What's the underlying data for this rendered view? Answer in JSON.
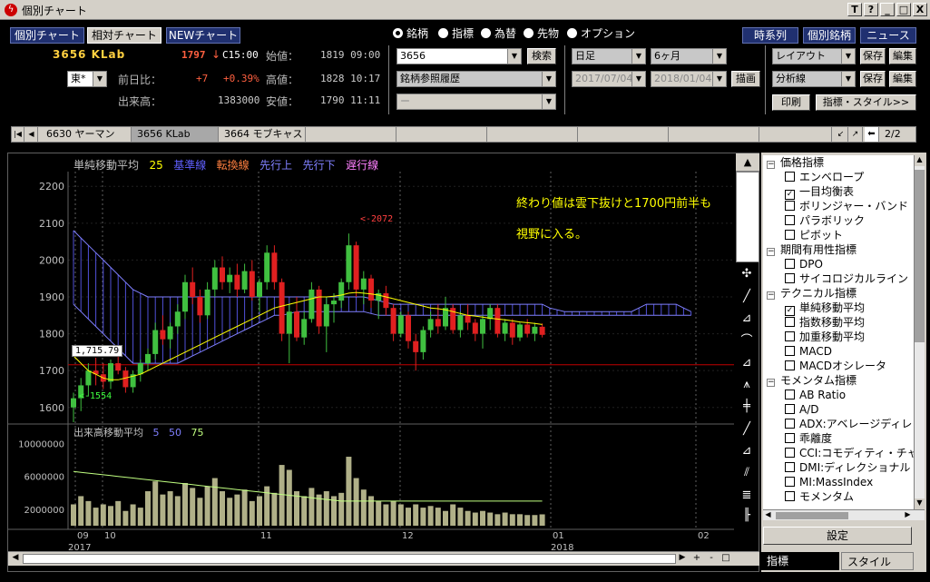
{
  "window": {
    "title": "個別チャート",
    "btn_t": "T",
    "btn_help": "?",
    "btn_min": "_",
    "btn_max": "□",
    "btn_close": "X"
  },
  "nav": {
    "tab_individual": "個別チャート",
    "tab_relative": "相対チャート",
    "tab_new": "NEWチャート"
  },
  "quote": {
    "code_name": "3656 KLab",
    "price": "1797",
    "arrow": "↓",
    "time": "C15:00",
    "open_label": "始値：",
    "open_value": "1819 09:00",
    "market": "東*",
    "change_label": "前日比：",
    "change": "+7",
    "change_pct": "+0.39%",
    "high_label": "高値：",
    "high_value": "1828 10:17",
    "volume_label": "出来高：",
    "volume": "1383000",
    "low_label": "安値：",
    "low_value": "1790 11:11"
  },
  "instrument_radios": [
    "銘柄",
    "指標",
    "為替",
    "先物",
    "オプション"
  ],
  "search": {
    "code": "3656",
    "search_btn": "検索",
    "history": "銘柄参照履歴",
    "empty": "ー"
  },
  "period": {
    "interval": "日足",
    "range": "6ヶ月",
    "from": "2017/07/04",
    "to": "2018/01/04",
    "draw_btn": "描画"
  },
  "right_buttons": {
    "timeseries": "時系列",
    "stock_name": "個別銘柄",
    "news": "ニュース",
    "layout": "レイアウト",
    "save": "保存",
    "edit": "編集",
    "analysis": "分析線",
    "print": "印刷",
    "indicator_style": "指標・スタイル>>"
  },
  "stock_tabs": [
    "6630 ヤーマン",
    "3656 KLab",
    "3664 モブキャス"
  ],
  "page_indicator": "2/2",
  "chart": {
    "legend": [
      {
        "text": "単純移動平均",
        "color": "#c0c0c0"
      },
      {
        "text": "25",
        "color": "#ffff00"
      },
      {
        "text": "基準線",
        "color": "#6060ff"
      },
      {
        "text": "転換線",
        "color": "#ff8040"
      },
      {
        "text": "先行上",
        "color": "#8080ff"
      },
      {
        "text": "先行下",
        "color": "#8080ff"
      },
      {
        "text": "遅行線",
        "color": "#ff80ff"
      }
    ],
    "annotation_line1": "終わり値は雲下抜けと1700円前半も",
    "annotation_line2": "視野に入る。",
    "high_marker": "<-2072",
    "low_marker": "<-1554",
    "cursor_value": "1,715.79",
    "price_ticks": [
      "2200",
      "2100",
      "2000",
      "1900",
      "1800",
      "1700",
      "1600"
    ],
    "volume_legend": [
      {
        "text": "出来高移動平均",
        "color": "#c0c0c0"
      },
      {
        "text": "5",
        "color": "#8080ff"
      },
      {
        "text": "50",
        "color": "#8080ff"
      },
      {
        "text": "75",
        "color": "#c0ff80"
      }
    ],
    "volume_ticks": [
      "10000000",
      "6000000",
      "2000000"
    ],
    "month_ticks": [
      "09",
      "10",
      "11",
      "12",
      "01",
      "02"
    ],
    "year_ticks": [
      "2017",
      "2018"
    ]
  },
  "chart_data": {
    "type": "candlestick",
    "title": "",
    "ylim": [
      1560,
      2240
    ],
    "price_ticks": [
      1600,
      1700,
      1800,
      1900,
      2000,
      2100,
      2200
    ],
    "reference_line": 1715.79,
    "candles": [
      [
        1600,
        1640,
        1560,
        1625
      ],
      [
        1625,
        1680,
        1590,
        1660
      ],
      [
        1660,
        1720,
        1630,
        1700
      ],
      [
        1700,
        1735,
        1660,
        1690
      ],
      [
        1690,
        1720,
        1650,
        1670
      ],
      [
        1670,
        1730,
        1650,
        1720
      ],
      [
        1720,
        1760,
        1690,
        1700
      ],
      [
        1700,
        1710,
        1640,
        1655
      ],
      [
        1655,
        1700,
        1640,
        1690
      ],
      [
        1690,
        1730,
        1670,
        1720
      ],
      [
        1720,
        1760,
        1700,
        1745
      ],
      [
        1745,
        1830,
        1730,
        1810
      ],
      [
        1810,
        1850,
        1770,
        1785
      ],
      [
        1785,
        1830,
        1760,
        1820
      ],
      [
        1820,
        1880,
        1800,
        1860
      ],
      [
        1860,
        1960,
        1840,
        1940
      ],
      [
        1940,
        1980,
        1880,
        1900
      ],
      [
        1900,
        1920,
        1830,
        1850
      ],
      [
        1850,
        1940,
        1840,
        1920
      ],
      [
        1920,
        2000,
        1900,
        1980
      ],
      [
        1980,
        2010,
        1920,
        1940
      ],
      [
        1940,
        1980,
        1910,
        1960
      ],
      [
        1960,
        1990,
        1900,
        1920
      ],
      [
        1920,
        1990,
        1910,
        1970
      ],
      [
        1970,
        2000,
        1890,
        1900
      ],
      [
        1900,
        1950,
        1860,
        1940
      ],
      [
        1940,
        2040,
        1920,
        2020
      ],
      [
        2020,
        2040,
        1920,
        1940
      ],
      [
        1940,
        1950,
        1780,
        1800
      ],
      [
        1800,
        1880,
        1720,
        1860
      ],
      [
        1860,
        1900,
        1780,
        1790
      ],
      [
        1790,
        1860,
        1770,
        1840
      ],
      [
        1840,
        1940,
        1830,
        1920
      ],
      [
        1920,
        1930,
        1800,
        1820
      ],
      [
        1820,
        1900,
        1750,
        1880
      ],
      [
        1880,
        1910,
        1830,
        1890
      ],
      [
        1890,
        1950,
        1870,
        1940
      ],
      [
        1940,
        2072,
        1920,
        2040
      ],
      [
        2040,
        2050,
        1900,
        1920
      ],
      [
        1920,
        1970,
        1880,
        1950
      ],
      [
        1950,
        1960,
        1870,
        1890
      ],
      [
        1890,
        1920,
        1840,
        1910
      ],
      [
        1910,
        1930,
        1850,
        1870
      ],
      [
        1870,
        1880,
        1780,
        1800
      ],
      [
        1800,
        1860,
        1790,
        1850
      ],
      [
        1850,
        1860,
        1760,
        1780
      ],
      [
        1780,
        1800,
        1700,
        1750
      ],
      [
        1750,
        1820,
        1730,
        1810
      ],
      [
        1810,
        1860,
        1790,
        1840
      ],
      [
        1840,
        1880,
        1800,
        1820
      ],
      [
        1820,
        1900,
        1810,
        1870
      ],
      [
        1870,
        1880,
        1800,
        1810
      ],
      [
        1810,
        1860,
        1790,
        1850
      ],
      [
        1850,
        1880,
        1810,
        1830
      ],
      [
        1830,
        1840,
        1780,
        1800
      ],
      [
        1800,
        1850,
        1760,
        1840
      ],
      [
        1840,
        1880,
        1810,
        1870
      ],
      [
        1870,
        1880,
        1790,
        1800
      ],
      [
        1800,
        1840,
        1780,
        1830
      ],
      [
        1830,
        1840,
        1770,
        1790
      ],
      [
        1790,
        1830,
        1780,
        1825
      ],
      [
        1825,
        1840,
        1790,
        1800
      ],
      [
        1800,
        1830,
        1780,
        1819
      ],
      [
        1819,
        1828,
        1790,
        1797
      ]
    ],
    "ma25": [
      1740,
      1720,
      1700,
      1690,
      1680,
      1675,
      1675,
      1680,
      1685,
      1690,
      1700,
      1710,
      1720,
      1730,
      1740,
      1750,
      1760,
      1770,
      1780,
      1790,
      1800,
      1810,
      1820,
      1830,
      1840,
      1850,
      1860,
      1870,
      1875,
      1880,
      1885,
      1890,
      1895,
      1900,
      1900,
      1902,
      1905,
      1910,
      1912,
      1910,
      1908,
      1905,
      1900,
      1895,
      1890,
      1885,
      1880,
      1875,
      1870,
      1868,
      1865,
      1860,
      1855,
      1850,
      1848,
      1845,
      1842,
      1840,
      1838,
      1835,
      1832,
      1830,
      1828,
      1825
    ],
    "cloud_upper": [
      2080,
      2060,
      2040,
      2020,
      2000,
      1980,
      1960,
      1940,
      1920,
      1910,
      1900,
      1900,
      1900,
      1900,
      1900,
      1900,
      1900,
      1900,
      1900,
      1900,
      1900,
      1900,
      1900,
      1900,
      1900,
      1900,
      1900,
      1900,
      1900,
      1900,
      1900,
      1900,
      1900,
      1900,
      1900,
      1900,
      1900,
      1900,
      1900,
      1900,
      1895,
      1890,
      1885,
      1880,
      1880,
      1880,
      1880,
      1880,
      1880,
      1880,
      1880,
      1880,
      1880,
      1880,
      1880,
      1880,
      1880,
      1880,
      1880,
      1880,
      1880,
      1880,
      1880,
      1880,
      1870,
      1865,
      1860,
      1860,
      1860,
      1860,
      1860,
      1860,
      1860,
      1860,
      1860,
      1860,
      1870,
      1880,
      1880,
      1880,
      1880,
      1880,
      1870,
      1860
    ],
    "cloud_lower": [
      1880,
      1860,
      1840,
      1820,
      1800,
      1780,
      1760,
      1740,
      1720,
      1720,
      1720,
      1720,
      1720,
      1720,
      1720,
      1730,
      1740,
      1750,
      1760,
      1770,
      1780,
      1790,
      1800,
      1810,
      1820,
      1830,
      1840,
      1850,
      1850,
      1855,
      1860,
      1860,
      1860,
      1860,
      1860,
      1860,
      1860,
      1860,
      1860,
      1860,
      1855,
      1850,
      1850,
      1850,
      1850,
      1850,
      1850,
      1850,
      1850,
      1850,
      1850,
      1850,
      1850,
      1850,
      1850,
      1850,
      1850,
      1850,
      1850,
      1850,
      1850,
      1850,
      1850,
      1850,
      1850,
      1850,
      1850,
      1850,
      1850,
      1850,
      1850,
      1850,
      1850,
      1850,
      1850,
      1850,
      1850,
      1850,
      1850,
      1850,
      1850,
      1850,
      1850,
      1850
    ],
    "volume_ylim": [
      0,
      11500000
    ],
    "volumes": [
      2600000,
      3600000,
      3000000,
      2200000,
      2600000,
      2400000,
      3000000,
      1800000,
      2600000,
      2200000,
      4200000,
      5400000,
      3800000,
      4200000,
      3600000,
      5200000,
      4600000,
      3400000,
      4800000,
      5800000,
      4200000,
      3400000,
      3800000,
      4400000,
      3000000,
      3600000,
      4800000,
      4000000,
      7400000,
      6800000,
      4200000,
      3600000,
      4600000,
      3800000,
      4200000,
      3600000,
      4000000,
      8400000,
      5800000,
      4400000,
      3600000,
      3000000,
      2600000,
      3000000,
      2600000,
      2200000,
      2600000,
      2200000,
      2400000,
      2200000,
      1800000,
      2600000,
      2200000,
      1800000,
      1600000,
      1800000,
      1600000,
      1400000,
      1600000,
      1400000,
      1400000,
      1300000,
      1300000,
      1383000
    ],
    "volume_ma_long": [
      6600000,
      6500000,
      6400000,
      6300000,
      6200000,
      6100000,
      6000000,
      5900000,
      5800000,
      5700000,
      5600000,
      5500000,
      5400000,
      5300000,
      5200000,
      5100000,
      5000000,
      4900000,
      4800000,
      4700000,
      4600000,
      4500000,
      4400000,
      4300000,
      4200000,
      4100000,
      4000000,
      3900000,
      3800000,
      3700000,
      3600000,
      3500000,
      3400000,
      3300000,
      3200000,
      3100000,
      3000000,
      3000000,
      3000000,
      3000000,
      3000000,
      3000000,
      3000000,
      3000000,
      3000000,
      3000000,
      3000000,
      3000000,
      3000000,
      3000000,
      3000000,
      3000000,
      3000000,
      3000000,
      3000000,
      3000000,
      3000000,
      3000000,
      3000000,
      3000000,
      3000000,
      3000000,
      3000000,
      3000000
    ]
  },
  "toolbox_icons": [
    "crosshair-icon",
    "trendline-icon",
    "fan-line-icon",
    "arc-icon",
    "fibonacci-icon",
    "channel-icon",
    "speed-line-icon",
    "ray-icon",
    "gann-icon",
    "regression-icon",
    "cycle-icon",
    "delete-icon"
  ],
  "tree": [
    {
      "type": "group",
      "label": "価格指標"
    },
    {
      "type": "item",
      "label": "エンベロープ",
      "checked": false
    },
    {
      "type": "item",
      "label": "一目均衡表",
      "checked": true
    },
    {
      "type": "item",
      "label": "ボリンジャー・バンド",
      "checked": false
    },
    {
      "type": "item",
      "label": "パラボリック",
      "checked": false
    },
    {
      "type": "item",
      "label": "ピボット",
      "checked": false
    },
    {
      "type": "group",
      "label": "期間有用性指標"
    },
    {
      "type": "item",
      "label": "DPO",
      "checked": false
    },
    {
      "type": "item",
      "label": "サイコロジカルライン",
      "checked": false
    },
    {
      "type": "group",
      "label": "テクニカル指標"
    },
    {
      "type": "item",
      "label": "単純移動平均",
      "checked": true
    },
    {
      "type": "item",
      "label": "指数移動平均",
      "checked": false
    },
    {
      "type": "item",
      "label": "加重移動平均",
      "checked": false
    },
    {
      "type": "item",
      "label": "MACD",
      "checked": false
    },
    {
      "type": "item",
      "label": "MACDオシレータ",
      "checked": false
    },
    {
      "type": "group",
      "label": "モメンタム指標"
    },
    {
      "type": "item",
      "label": "AB Ratio",
      "checked": false
    },
    {
      "type": "item",
      "label": "A/D",
      "checked": false
    },
    {
      "type": "item",
      "label": "ADX:アベレージディレ",
      "checked": false
    },
    {
      "type": "item",
      "label": "乖離度",
      "checked": false
    },
    {
      "type": "item",
      "label": "CCI:コモディティ・チャ",
      "checked": false
    },
    {
      "type": "item",
      "label": "DMI:ディレクショナル",
      "checked": false
    },
    {
      "type": "item",
      "label": "MI:MassIndex",
      "checked": false
    },
    {
      "type": "item",
      "label": "モメンタム",
      "checked": false
    }
  ],
  "panel": {
    "settings_btn": "設定",
    "tab_indicator": "指標",
    "tab_style": "スタイル"
  },
  "colors": {
    "up": "#40c040",
    "down": "#e02020",
    "ma25": "#ffff00",
    "cloud": "#6060ff",
    "volume_bar": "#b0b088",
    "annotation": "#ffff00",
    "navy": "#203070"
  }
}
